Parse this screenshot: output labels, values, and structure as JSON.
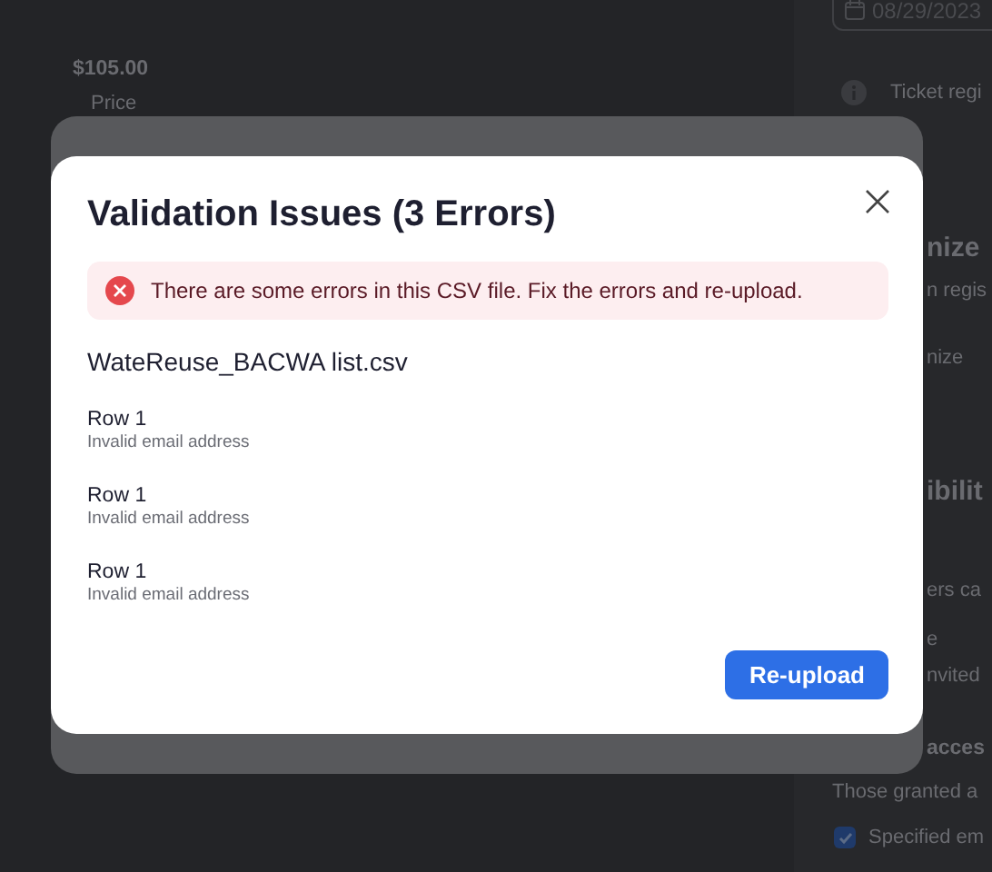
{
  "background": {
    "price": "$105.00",
    "price_label": "Price",
    "date": "08/29/2023",
    "notice": "Ticket regi",
    "fragments": [
      {
        "text": "nize",
        "kind": "heading"
      },
      {
        "text": "n regis",
        "kind": "text"
      },
      {
        "text": "nize",
        "kind": "text"
      },
      {
        "text": "ibilit",
        "kind": "heading"
      },
      {
        "text": "ers ca",
        "kind": "text"
      },
      {
        "text": "e",
        "kind": "text"
      },
      {
        "text": "nvited",
        "kind": "text"
      },
      {
        "text": "acces",
        "kind": "label"
      }
    ],
    "access_note": "Those granted a",
    "option": {
      "label": "Specified em",
      "checked": true
    }
  },
  "dialog": {
    "title": "Validation Issues (3 Errors)",
    "alert": "There are some errors in this CSV file. Fix the errors and re-upload.",
    "file_name": "WateReuse_BACWA list.csv",
    "errors": [
      {
        "row": "Row 1",
        "message": "Invalid email address"
      },
      {
        "row": "Row 1",
        "message": "Invalid email address"
      },
      {
        "row": "Row 1",
        "message": "Invalid email address"
      }
    ],
    "button": "Re-upload"
  }
}
